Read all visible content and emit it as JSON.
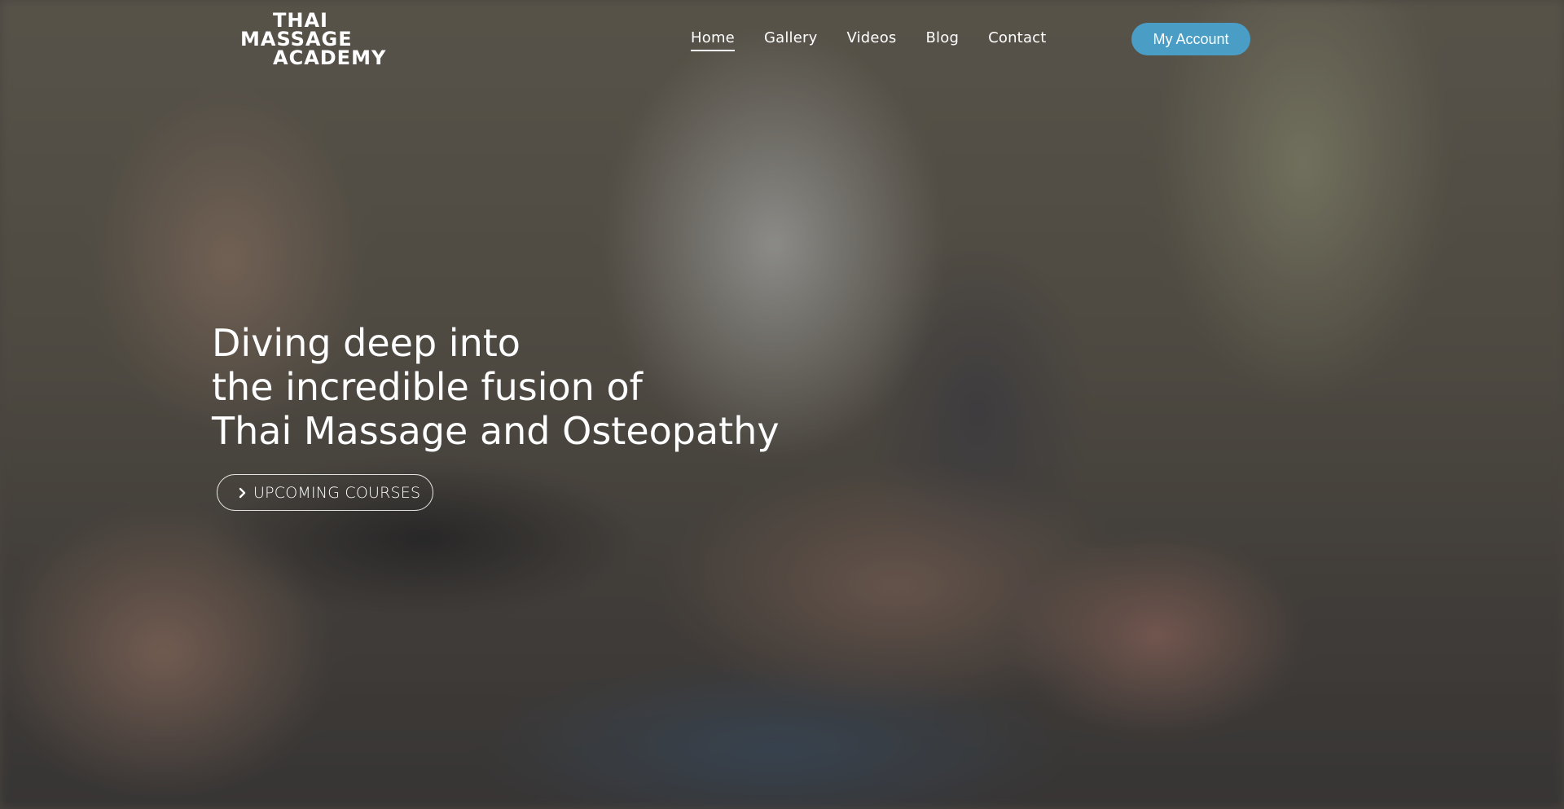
{
  "header": {
    "logo": {
      "line1": "THAI",
      "line2": "MASSAGE",
      "line3": "ACADEMY"
    },
    "nav": [
      {
        "label": "Home",
        "active": true
      },
      {
        "label": "Gallery",
        "active": false
      },
      {
        "label": "Videos",
        "active": false
      },
      {
        "label": "Blog",
        "active": false
      },
      {
        "label": "Contact",
        "active": false
      }
    ],
    "account_label": "My Account"
  },
  "hero": {
    "heading_lines": [
      "Diving deep into",
      "the incredible fusion of",
      "Thai Massage and Osteopathy"
    ],
    "cta_label": "UPCOMING COURSES",
    "cta_icon": "chevron-right-icon"
  },
  "colors": {
    "accent": "#4a9dc4",
    "text": "#ffffff"
  }
}
